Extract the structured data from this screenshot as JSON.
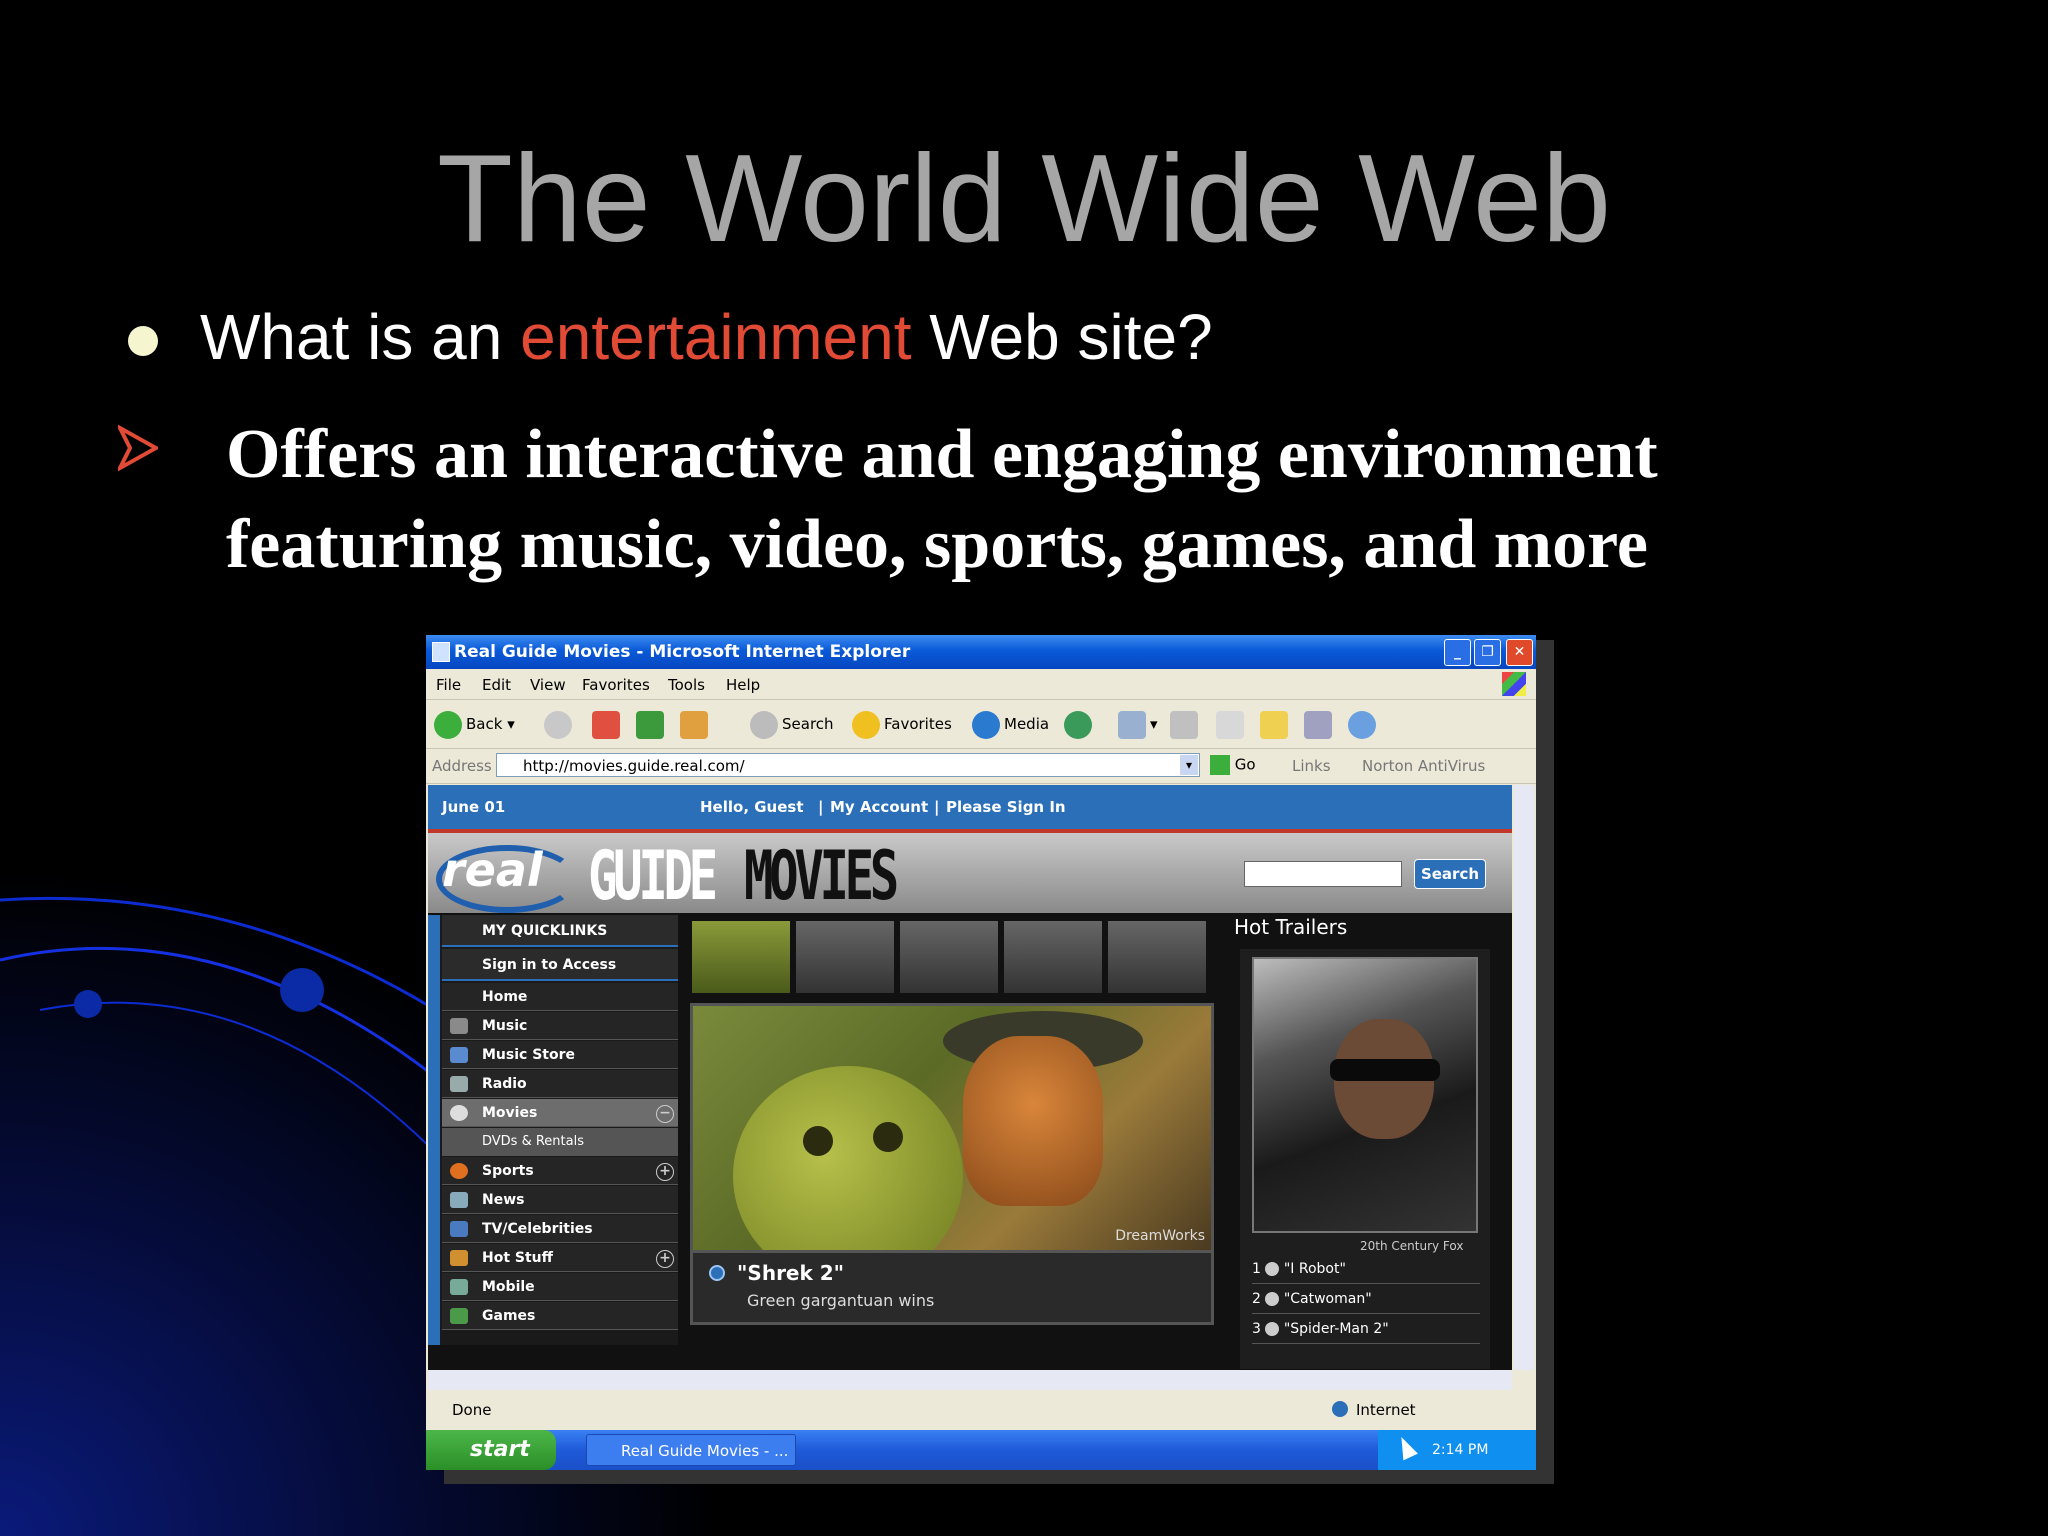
{
  "slide": {
    "title": "The World Wide Web",
    "bullet_prefix": "What is an ",
    "bullet_accent": "entertainment",
    "bullet_suffix": " Web site?",
    "sub_point_line1": "Offers an interactive and engaging environment",
    "sub_point_line2": "featuring music, video, sports, games, and more"
  },
  "colors": {
    "title": "#a6a6a6",
    "accent": "#e14a35",
    "xp_blue": "#0a5ad8",
    "site_blue": "#2a6fb8"
  },
  "browser": {
    "window_title": "Real Guide Movies - Microsoft Internet Explorer",
    "menu": [
      "File",
      "Edit",
      "View",
      "Favorites",
      "Tools",
      "Help"
    ],
    "toolbar": {
      "back": "Back",
      "search": "Search",
      "favorites": "Favorites",
      "media": "Media"
    },
    "address_label": "Address",
    "address_url": "http://movies.guide.real.com/",
    "go": "Go",
    "links": "Links",
    "norton": "Norton AntiVirus",
    "status_text": "Done",
    "status_zone": "Internet"
  },
  "site": {
    "date": "June 01",
    "greeting": "Hello, Guest",
    "account": "My Account",
    "sign_in": "Please Sign In",
    "logo_real": "real",
    "logo_guide": "GUIDE",
    "logo_movies": "MOVIES",
    "search_button": "Search",
    "quicklinks": "MY QUICKLINKS",
    "sign_in_access": "Sign in to Access",
    "nav": [
      "Home",
      "Music",
      "Music Store",
      "Radio",
      "Movies",
      "DVDs & Rentals",
      "Sports",
      "News",
      "TV/Celebrities",
      "Hot Stuff",
      "Mobile",
      "Games"
    ],
    "feature_title": "\"Shrek 2\"",
    "feature_sub": "Green gargantuan wins",
    "feature_watermark": "DreamWorks",
    "hot_trailers": "Hot Trailers",
    "trailer_credit": "20th Century Fox",
    "trailers": [
      "1",
      "\"I Robot\"",
      "2",
      "\"Catwoman\"",
      "3",
      "\"Spider-Man 2\""
    ]
  },
  "taskbar": {
    "start": "start",
    "task": "Real Guide Movies - ...",
    "clock": "2:14 PM"
  }
}
